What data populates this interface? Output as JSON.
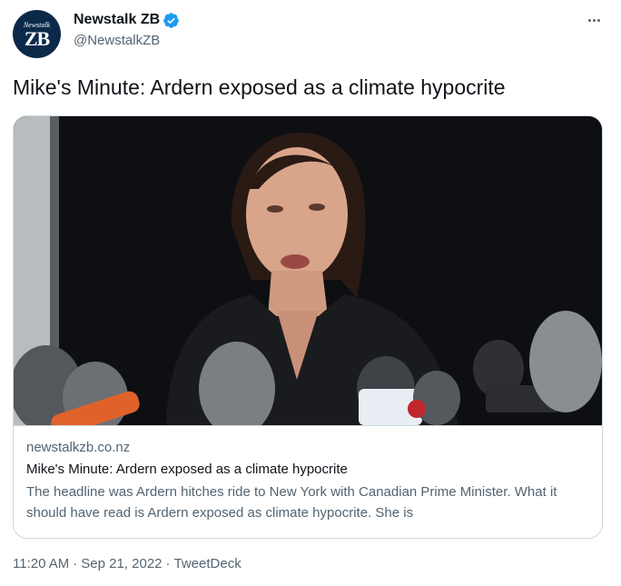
{
  "author": {
    "display_name": "Newstalk ZB",
    "handle": "@NewstalkZB",
    "avatar_text_small": "Newstalk",
    "avatar_text_big": "ZB",
    "verified": true,
    "verified_color": "#1d9bf0"
  },
  "tweet": {
    "text": "Mike's Minute: Ardern exposed as a climate hypocrite"
  },
  "card": {
    "domain": "newstalkzb.co.nz",
    "title": "Mike's Minute: Ardern exposed as a climate hypocrite",
    "description": "The headline was Ardern hitches ride to New York with Canadian Prime Minister. What it should have read is Ardern exposed as climate hypocrite. She is",
    "image_alt_icon": "press-conference-photo"
  },
  "meta": {
    "time": "11:20 AM",
    "separator": "·",
    "date": "Sep 21, 2022",
    "source": "TweetDeck"
  },
  "colors": {
    "text_primary": "#0f1419",
    "text_secondary": "#536471",
    "border": "#cfd9de"
  },
  "icons": {
    "more": "more-horizontal-icon",
    "verified": "verified-badge-icon"
  }
}
